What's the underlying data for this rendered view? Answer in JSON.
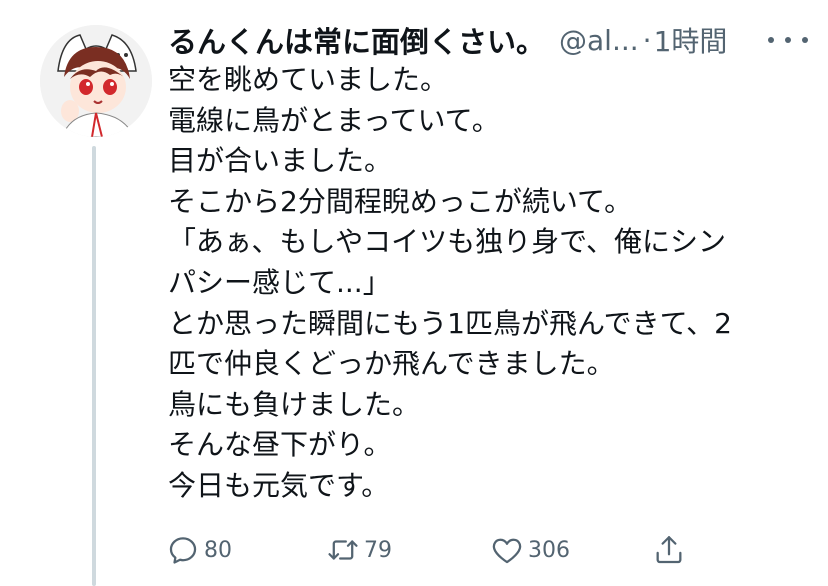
{
  "tweet": {
    "author_name": "るんくんは常に面倒くさい。",
    "author_handle": "@al...",
    "separator": "·",
    "timestamp": "1時間",
    "lines": [
      "空を眺めていました。",
      "電線に鳥がとまっていて。",
      "目が合いました。",
      "そこから2分間程睨めっこが続いて。",
      "「あぁ、もしやコイツも独り身で、俺にシン",
      "パシー感じて...」",
      "とか思った瞬間にもう1匹鳥が飛んできて、2",
      "匹で仲良くどっか飛んできました。",
      "鳥にも負けました。",
      "そんな昼下がり。",
      "今日も元気です。"
    ]
  },
  "actions": {
    "reply_count": "80",
    "retweet_count": "79",
    "like_count": "306"
  },
  "icons": {
    "reply": "reply-icon",
    "retweet": "retweet-icon",
    "like": "heart-icon",
    "share": "share-icon",
    "more": "more-icon"
  },
  "colors": {
    "text": "#0f1419",
    "secondary": "#536471",
    "thread_line": "#cfd9de"
  }
}
